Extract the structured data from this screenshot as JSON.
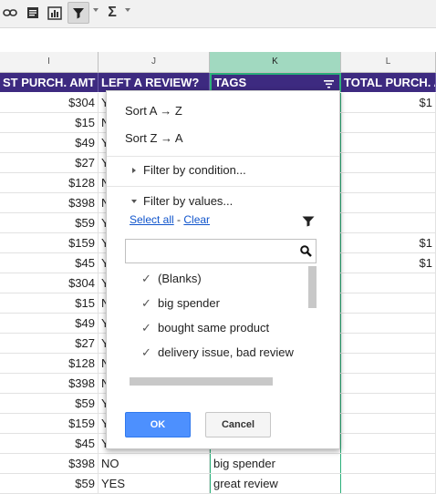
{
  "toolbar": {
    "icons": [
      "link-icon",
      "comment-icon",
      "chart-icon",
      "filter-icon",
      "functions-icon"
    ],
    "functions_glyph": "Σ"
  },
  "columns": [
    "I",
    "J",
    "K",
    "L"
  ],
  "headers": [
    "ST PURCH. AMT",
    "LEFT A REVIEW?",
    "TAGS",
    "TOTAL PURCH. A"
  ],
  "rows": [
    {
      "amt": "$304",
      "review": "Y",
      "total": "$1"
    },
    {
      "amt": "$15",
      "review": "N",
      "total": ""
    },
    {
      "amt": "$49",
      "review": "Y",
      "total": ""
    },
    {
      "amt": "$27",
      "review": "Y",
      "total": ""
    },
    {
      "amt": "$128",
      "review": "N",
      "total": ""
    },
    {
      "amt": "$398",
      "review": "N",
      "total": ""
    },
    {
      "amt": "$59",
      "review": "Y",
      "total": ""
    },
    {
      "amt": "$159",
      "review": "Y",
      "total": "$1"
    },
    {
      "amt": "$45",
      "review": "Y",
      "total": "$1"
    },
    {
      "amt": "$304",
      "review": "Y",
      "total": ""
    },
    {
      "amt": "$15",
      "review": "N",
      "total": ""
    },
    {
      "amt": "$49",
      "review": "Y",
      "total": ""
    },
    {
      "amt": "$27",
      "review": "Y",
      "total": ""
    },
    {
      "amt": "$128",
      "review": "N",
      "total": ""
    },
    {
      "amt": "$398",
      "review": "N",
      "total": ""
    },
    {
      "amt": "$59",
      "review": "Y",
      "total": ""
    },
    {
      "amt": "$159",
      "review": "Y",
      "total": ""
    },
    {
      "amt": "$45",
      "review": "Y",
      "total": ""
    },
    {
      "amt": "$398",
      "review": "NO",
      "tags": "big spender",
      "total": ""
    },
    {
      "amt": "$59",
      "review": "YES",
      "tags": "great review",
      "total": ""
    }
  ],
  "menu": {
    "sort_az": "Sort A → Z",
    "sort_za": "Sort Z → A",
    "filter_condition": "Filter by condition...",
    "filter_values": "Filter by values...",
    "select_all": "Select all",
    "link_sep": " - ",
    "clear": "Clear",
    "search_placeholder": "",
    "values": [
      "(Blanks)",
      "big spender",
      "bought same product",
      "delivery issue, bad review"
    ],
    "ok": "OK",
    "cancel": "Cancel"
  },
  "colors": {
    "header_bg": "#3d2a80",
    "selected_column": "#a1d9c0",
    "ok_button": "#4d90fe"
  }
}
